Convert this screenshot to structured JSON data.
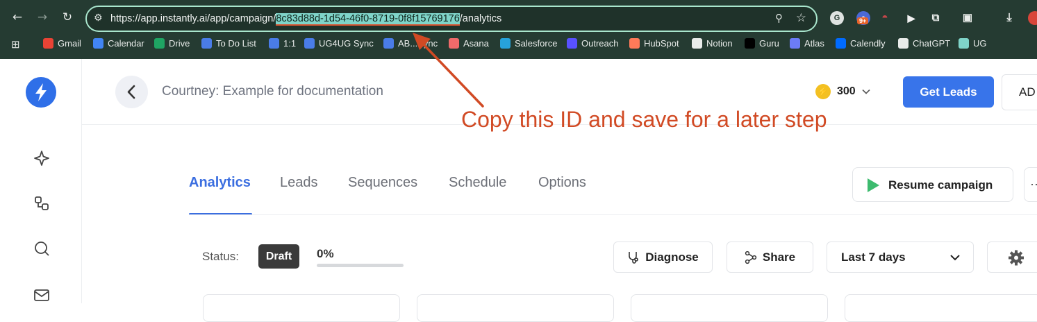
{
  "browser": {
    "url_prefix": "https://app.instantly.ai/app/campaign/",
    "url_id": "8c83d88d-1d54-46f0-8719-0f8f15769176",
    "url_suffix": "/analytics",
    "ext_badge": "9+",
    "bookmarks": [
      {
        "label": "Gmail",
        "icon": "gmail-icon",
        "color": "#ea4335"
      },
      {
        "label": "Calendar",
        "icon": "calendar-icon",
        "color": "#4285f4"
      },
      {
        "label": "Drive",
        "icon": "drive-icon",
        "color": "#1fa463"
      },
      {
        "label": "To Do List",
        "icon": "docs-icon",
        "color": "#4a7ce8"
      },
      {
        "label": "1:1",
        "icon": "docs-icon",
        "color": "#4a7ce8"
      },
      {
        "label": "UG4UG Sync",
        "icon": "docs-icon",
        "color": "#4a7ce8"
      },
      {
        "label": "AB...Sync",
        "icon": "docs-icon",
        "color": "#4a7ce8"
      },
      {
        "label": "Asana",
        "icon": "asana-icon",
        "color": "#f06a6a"
      },
      {
        "label": "Salesforce",
        "icon": "salesforce-icon",
        "color": "#27a2db"
      },
      {
        "label": "Outreach",
        "icon": "outreach-icon",
        "color": "#5951ff"
      },
      {
        "label": "HubSpot",
        "icon": "hubspot-icon",
        "color": "#ff7a59"
      },
      {
        "label": "Notion",
        "icon": "notion-icon",
        "color": "#e9ecea"
      },
      {
        "label": "Guru",
        "icon": "guru-icon",
        "color": "#000000"
      },
      {
        "label": "Atlas",
        "icon": "atlas-icon",
        "color": "#6c7cf7"
      },
      {
        "label": "Calendly",
        "icon": "calendly-icon",
        "color": "#006bff"
      },
      {
        "label": "ChatGPT",
        "icon": "chatgpt-icon",
        "color": "#e9ecea"
      },
      {
        "label": "UG",
        "icon": "ug-icon",
        "color": "#7fd4c9"
      }
    ]
  },
  "header": {
    "campaign_title": "Courtney: Example for documentation",
    "credits": "300",
    "get_leads": "Get Leads",
    "ad_label": "AD"
  },
  "annotation": {
    "text": "Copy this ID and save for a later step"
  },
  "tabs": [
    "Analytics",
    "Leads",
    "Sequences",
    "Schedule",
    "Options"
  ],
  "active_tab": "Analytics",
  "actions": {
    "resume": "Resume campaign"
  },
  "status": {
    "label": "Status:",
    "badge": "Draft",
    "progress_text": "0%",
    "progress_fraction": 0
  },
  "toolbar": {
    "diagnose": "Diagnose",
    "share": "Share",
    "range": "Last 7 days"
  },
  "colors": {
    "accent": "#3b6ee0",
    "chrome_bg": "#253b32",
    "annotation": "#d14a24",
    "play": "#3dbb6f"
  }
}
